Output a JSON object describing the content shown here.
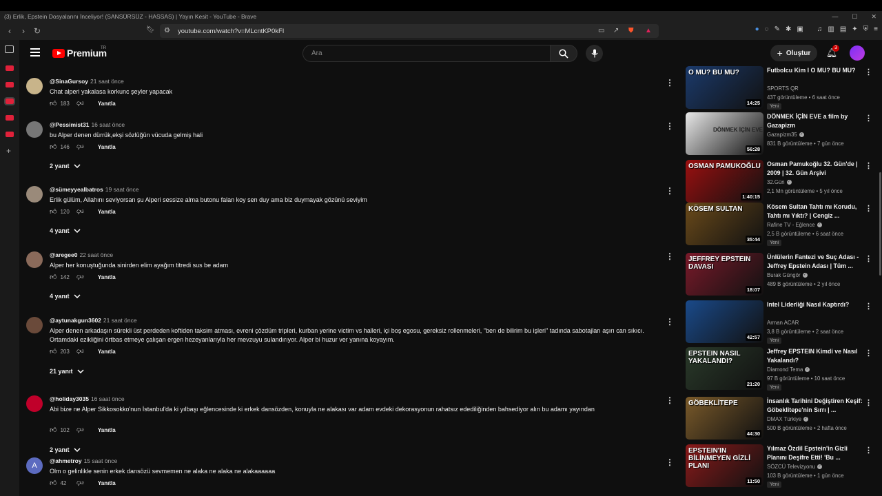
{
  "browser": {
    "window_title": "(3) Erlik, Epstein Dosyalarını İnceliyor! (SANSÜRSÜZ - HASSAS) | Yayın Kesit - YouTube - Brave",
    "url": "youtube.com/watch?v=MLcntKP0kFI"
  },
  "header": {
    "logo_text": "Premium",
    "logo_region": "TR",
    "search_placeholder": "Ara",
    "create_label": "Oluştur",
    "notification_count": "3"
  },
  "comments": [
    {
      "handle": "@SinaGursoy",
      "time": "21 saat önce",
      "text": "Chat alperi yakalasa korkunc şeyler yapacak",
      "likes": "183",
      "reply_label": "Yanıtla",
      "replies": "",
      "avatar_color": "#c8b48a"
    },
    {
      "handle": "@Pessimist31",
      "time": "16 saat önce",
      "text": "bu Alper denen dürrük,ekşi sözlüğün vücuda gelmiş hali",
      "likes": "146",
      "reply_label": "Yanıtla",
      "replies": "2 yanıt",
      "avatar_color": "#777"
    },
    {
      "handle": "@sümeyyealbatros",
      "time": "19 saat önce",
      "text": "Erlik gülüm, Allahını seviyorsan şu Alperi  sessize alma butonu falan koy sen duy ama biz duymayak gözünü seviyim",
      "likes": "120",
      "reply_label": "Yanıtla",
      "replies": "4 yanıt",
      "avatar_color": "#9a8a7a"
    },
    {
      "handle": "@aregee0",
      "time": "22 saat önce",
      "text": "Alper her konuştuğunda sinirden elim ayağım titredi sus be adam",
      "likes": "142",
      "reply_label": "Yanıtla",
      "replies": "4 yanıt",
      "avatar_color": "#8a6a5a"
    },
    {
      "handle": "@aytunakgun3602",
      "time": "21 saat önce",
      "text": "Alper denen arkadaşın sürekli üst perdeden koftiden taksim atması, evreni çözdüm tripleri, kurban yerine victim vs halleri, içi boş egosu, gereksiz rollenmeleri, \"ben de bilirim bu işleri\" tadında sabotajları aşırı can sıkıcı. Ortamdaki ezikliğini örtbas etmeye çalışan ergen hezeyanlarıyla her mevzuyu sulandırıyor. Alper bi huzur ver yanına koyayım.",
      "likes": "203",
      "reply_label": "Yanıtla",
      "replies": "21 yanıt",
      "avatar_color": "#6a4a3a"
    },
    {
      "handle": "@holiday3035",
      "time": "16 saat önce",
      "text": "Abi bize ne Alper Sikkosokko'nun İstanbul'da ki yılbaşı eğlencesinde ki erkek dansözden, konuyla ne alakası var adam evdeki dekorasyonun rahatsız edediliğinden bahsediyor alın bu adamı yayından",
      "likes": "102",
      "reply_label": "Yanıtla",
      "replies": "2 yanıt",
      "avatar_color": "#c0002a"
    },
    {
      "handle": "@ahmetroy",
      "time": "15 saat önce",
      "text": "Olm o gelinlikle senin erkek dansözü sevmemen ne alaka ne alaka ne alakaaaaaa",
      "likes": "42",
      "reply_label": "Yanıtla",
      "replies": "",
      "avatar_letter": "A",
      "avatar_color": "#5c6bc0"
    }
  ],
  "videos": [
    {
      "title": "Futbolcu Kim I O MU? BU MU?",
      "channel": "SPORTS QR",
      "meta": "437 görüntüleme • 6 saat önce",
      "badge": "Yeni",
      "duration": "14:25",
      "thumb_text": "O MU? BU MU?",
      "thumb_color": "#1b3a6b",
      "verified": false
    },
    {
      "title": "DÖNMEK İÇİN EVE a film by Gazapizm",
      "channel": "Gazapizm35",
      "meta": "831 B görüntüleme • 7 gün önce",
      "badge": "",
      "duration": "56:28",
      "thumb_text": "DÖNMEK İÇİN EVE",
      "thumb_color": "#e8e8e8",
      "verified": true
    },
    {
      "title": "Osman Pamukoğlu 32. Gün'de | 2009 | 32. Gün Arşivi",
      "channel": "32.Gün",
      "meta": "2,1 Mn görüntüleme • 5 yıl önce",
      "badge": "",
      "duration": "1:40:15",
      "thumb_text": "OSMAN PAMUKOĞLU",
      "thumb_color": "#9b1010",
      "verified": true
    },
    {
      "title": "Kösem Sultan Tahtı mı Korudu, Tahtı mı Yıktı? | Cengiz ...",
      "channel": "Rafine TV - Eğlence",
      "meta": "2,5 B görüntüleme • 6 saat önce",
      "badge": "Yeni",
      "duration": "35:44",
      "thumb_text": "KÖSEM SULTAN",
      "thumb_color": "#6a4a1a",
      "verified": true
    },
    {
      "title": "Ünlülerin Fantezi ve Suç Adası - Jeffrey Epstein Adası | Tüm ...",
      "channel": "Burak Güngör",
      "meta": "489 B görüntüleme • 2 yıl önce",
      "badge": "",
      "duration": "18:07",
      "thumb_text": "JEFFREY EPSTEIN DAVASI",
      "thumb_color": "#7a1a2a",
      "verified": true
    },
    {
      "title": "Intel Liderliği Nasıl Kaptırdı?",
      "channel": "Arman ACAR",
      "meta": "3,8 B görüntüleme • 2 saat önce",
      "badge": "Yeni",
      "duration": "42:57",
      "thumb_text": "",
      "thumb_color": "#1a4a8a",
      "verified": false
    },
    {
      "title": "Jeffrey EPSTEIN Kimdi ve Nasıl Yakalandı?",
      "channel": "Diamond Tema",
      "meta": "97 B görüntüleme • 10 saat önce",
      "badge": "Yeni",
      "duration": "21:20",
      "thumb_text": "EPSTEIN NASIL YAKALANDI?",
      "thumb_color": "#2a3a2a",
      "verified": true
    },
    {
      "title": "İnsanlık Tarihini Değiştiren Keşif: Göbeklitepe'nin Sırrı | ...",
      "channel": "DMAX Türkiye",
      "meta": "500 B görüntüleme • 2 hafta önce",
      "badge": "",
      "duration": "44:30",
      "thumb_text": "GÖBEKLİTEPE",
      "thumb_color": "#7a5a2a",
      "verified": true
    },
    {
      "title": "Yılmaz Özdil Epstein'in Gizli Planını Deşifre Etti! 'Bu ...",
      "channel": "SÖZCÜ Televizyonu",
      "meta": "103 B görüntüleme • 1 gün önce",
      "badge": "Yeni",
      "duration": "11:50",
      "thumb_text": "EPSTEIN'IN BİLİNMEYEN GİZLİ PLANI",
      "thumb_color": "#8a1a1a",
      "verified": true
    }
  ]
}
